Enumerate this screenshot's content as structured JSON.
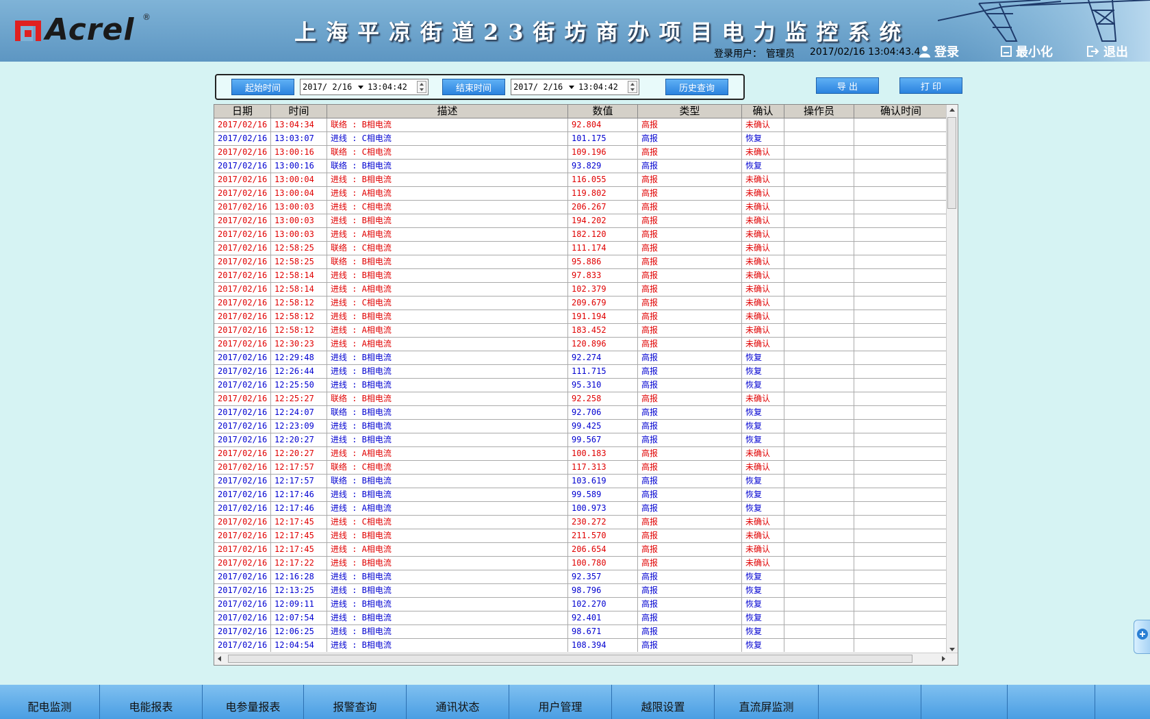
{
  "header": {
    "logo_text": "Acrel",
    "logo_mark": "®",
    "title": "上海平凉街道23街坊商办项目电力监控系统",
    "login_user_label": "登录用户：",
    "login_user": "管理员",
    "datetime": "2017/02/16   13:04:43.4",
    "login_btn": "登录",
    "minimize_btn": "最小化",
    "exit_btn": "退出"
  },
  "query": {
    "start_btn": "起始时间",
    "start_date": "2017/ 2/16",
    "start_time": "13:04:42",
    "end_btn": "结束时间",
    "end_date": "2017/ 2/16",
    "end_time": "13:04:42",
    "history_btn": "历史查询",
    "export_btn": "导 出",
    "print_btn": "打 印"
  },
  "table": {
    "columns": [
      "日期",
      "时间",
      "描述",
      "数值",
      "类型",
      "确认",
      "操作员",
      "确认时间"
    ],
    "rows": [
      {
        "date": "2017/02/16",
        "time": "13:04:34",
        "desc": "联络 : B相电流",
        "value": "92.804",
        "type": "高报",
        "status": "未确认",
        "color": "red"
      },
      {
        "date": "2017/02/16",
        "time": "13:03:07",
        "desc": "进线 : C相电流",
        "value": "101.175",
        "type": "高报",
        "status": "恢复",
        "color": "blue"
      },
      {
        "date": "2017/02/16",
        "time": "13:00:16",
        "desc": "联络 : C相电流",
        "value": "109.196",
        "type": "高报",
        "status": "未确认",
        "color": "red"
      },
      {
        "date": "2017/02/16",
        "time": "13:00:16",
        "desc": "联络 : B相电流",
        "value": "93.829",
        "type": "高报",
        "status": "恢复",
        "color": "blue"
      },
      {
        "date": "2017/02/16",
        "time": "13:00:04",
        "desc": "进线 : B相电流",
        "value": "116.055",
        "type": "高报",
        "status": "未确认",
        "color": "red"
      },
      {
        "date": "2017/02/16",
        "time": "13:00:04",
        "desc": "进线 : A相电流",
        "value": "119.802",
        "type": "高报",
        "status": "未确认",
        "color": "red"
      },
      {
        "date": "2017/02/16",
        "time": "13:00:03",
        "desc": "进线 : C相电流",
        "value": "206.267",
        "type": "高报",
        "status": "未确认",
        "color": "red"
      },
      {
        "date": "2017/02/16",
        "time": "13:00:03",
        "desc": "进线 : B相电流",
        "value": "194.202",
        "type": "高报",
        "status": "未确认",
        "color": "red"
      },
      {
        "date": "2017/02/16",
        "time": "13:00:03",
        "desc": "进线 : A相电流",
        "value": "182.120",
        "type": "高报",
        "status": "未确认",
        "color": "red"
      },
      {
        "date": "2017/02/16",
        "time": "12:58:25",
        "desc": "联络 : C相电流",
        "value": "111.174",
        "type": "高报",
        "status": "未确认",
        "color": "red"
      },
      {
        "date": "2017/02/16",
        "time": "12:58:25",
        "desc": "联络 : B相电流",
        "value": "95.886",
        "type": "高报",
        "status": "未确认",
        "color": "red"
      },
      {
        "date": "2017/02/16",
        "time": "12:58:14",
        "desc": "进线 : B相电流",
        "value": "97.833",
        "type": "高报",
        "status": "未确认",
        "color": "red"
      },
      {
        "date": "2017/02/16",
        "time": "12:58:14",
        "desc": "进线 : A相电流",
        "value": "102.379",
        "type": "高报",
        "status": "未确认",
        "color": "red"
      },
      {
        "date": "2017/02/16",
        "time": "12:58:12",
        "desc": "进线 : C相电流",
        "value": "209.679",
        "type": "高报",
        "status": "未确认",
        "color": "red"
      },
      {
        "date": "2017/02/16",
        "time": "12:58:12",
        "desc": "进线 : B相电流",
        "value": "191.194",
        "type": "高报",
        "status": "未确认",
        "color": "red"
      },
      {
        "date": "2017/02/16",
        "time": "12:58:12",
        "desc": "进线 : A相电流",
        "value": "183.452",
        "type": "高报",
        "status": "未确认",
        "color": "red"
      },
      {
        "date": "2017/02/16",
        "time": "12:30:23",
        "desc": "进线 : A相电流",
        "value": "120.896",
        "type": "高报",
        "status": "未确认",
        "color": "red"
      },
      {
        "date": "2017/02/16",
        "time": "12:29:48",
        "desc": "进线 : B相电流",
        "value": "92.274",
        "type": "高报",
        "status": "恢复",
        "color": "blue"
      },
      {
        "date": "2017/02/16",
        "time": "12:26:44",
        "desc": "进线 : B相电流",
        "value": "111.715",
        "type": "高报",
        "status": "恢复",
        "color": "blue"
      },
      {
        "date": "2017/02/16",
        "time": "12:25:50",
        "desc": "进线 : B相电流",
        "value": "95.310",
        "type": "高报",
        "status": "恢复",
        "color": "blue"
      },
      {
        "date": "2017/02/16",
        "time": "12:25:27",
        "desc": "联络 : B相电流",
        "value": "92.258",
        "type": "高报",
        "status": "未确认",
        "color": "red"
      },
      {
        "date": "2017/02/16",
        "time": "12:24:07",
        "desc": "联络 : B相电流",
        "value": "92.706",
        "type": "高报",
        "status": "恢复",
        "color": "blue"
      },
      {
        "date": "2017/02/16",
        "time": "12:23:09",
        "desc": "进线 : B相电流",
        "value": "99.425",
        "type": "高报",
        "status": "恢复",
        "color": "blue"
      },
      {
        "date": "2017/02/16",
        "time": "12:20:27",
        "desc": "进线 : B相电流",
        "value": "99.567",
        "type": "高报",
        "status": "恢复",
        "color": "blue"
      },
      {
        "date": "2017/02/16",
        "time": "12:20:27",
        "desc": "进线 : A相电流",
        "value": "100.183",
        "type": "高报",
        "status": "未确认",
        "color": "red"
      },
      {
        "date": "2017/02/16",
        "time": "12:17:57",
        "desc": "联络 : C相电流",
        "value": "117.313",
        "type": "高报",
        "status": "未确认",
        "color": "red"
      },
      {
        "date": "2017/02/16",
        "time": "12:17:57",
        "desc": "联络 : B相电流",
        "value": "103.619",
        "type": "高报",
        "status": "恢复",
        "color": "blue"
      },
      {
        "date": "2017/02/16",
        "time": "12:17:46",
        "desc": "进线 : B相电流",
        "value": "99.589",
        "type": "高报",
        "status": "恢复",
        "color": "blue"
      },
      {
        "date": "2017/02/16",
        "time": "12:17:46",
        "desc": "进线 : A相电流",
        "value": "100.973",
        "type": "高报",
        "status": "恢复",
        "color": "blue"
      },
      {
        "date": "2017/02/16",
        "time": "12:17:45",
        "desc": "进线 : C相电流",
        "value": "230.272",
        "type": "高报",
        "status": "未确认",
        "color": "red"
      },
      {
        "date": "2017/02/16",
        "time": "12:17:45",
        "desc": "进线 : B相电流",
        "value": "211.570",
        "type": "高报",
        "status": "未确认",
        "color": "red"
      },
      {
        "date": "2017/02/16",
        "time": "12:17:45",
        "desc": "进线 : A相电流",
        "value": "206.654",
        "type": "高报",
        "status": "未确认",
        "color": "red"
      },
      {
        "date": "2017/02/16",
        "time": "12:17:22",
        "desc": "进线 : B相电流",
        "value": "100.780",
        "type": "高报",
        "status": "未确认",
        "color": "red"
      },
      {
        "date": "2017/02/16",
        "time": "12:16:28",
        "desc": "进线 : B相电流",
        "value": "92.357",
        "type": "高报",
        "status": "恢复",
        "color": "blue"
      },
      {
        "date": "2017/02/16",
        "time": "12:13:25",
        "desc": "进线 : B相电流",
        "value": "98.796",
        "type": "高报",
        "status": "恢复",
        "color": "blue"
      },
      {
        "date": "2017/02/16",
        "time": "12:09:11",
        "desc": "进线 : B相电流",
        "value": "102.270",
        "type": "高报",
        "status": "恢复",
        "color": "blue"
      },
      {
        "date": "2017/02/16",
        "time": "12:07:54",
        "desc": "进线 : B相电流",
        "value": "92.401",
        "type": "高报",
        "status": "恢复",
        "color": "blue"
      },
      {
        "date": "2017/02/16",
        "time": "12:06:25",
        "desc": "进线 : B相电流",
        "value": "98.671",
        "type": "高报",
        "status": "恢复",
        "color": "blue"
      },
      {
        "date": "2017/02/16",
        "time": "12:04:54",
        "desc": "进线 : B相电流",
        "value": "108.394",
        "type": "高报",
        "status": "恢复",
        "color": "blue"
      }
    ]
  },
  "nav": {
    "items": [
      "配电监测",
      "电能报表",
      "电参量报表",
      "报警查询",
      "通讯状态",
      "用户管理",
      "越限设置",
      "直流屏监测",
      "",
      "",
      ""
    ]
  },
  "colors": {
    "alarm_red": "#e00000",
    "restore_blue": "#0000d0",
    "button_blue": "#2b83df",
    "page_bg": "#d6f3f3"
  }
}
